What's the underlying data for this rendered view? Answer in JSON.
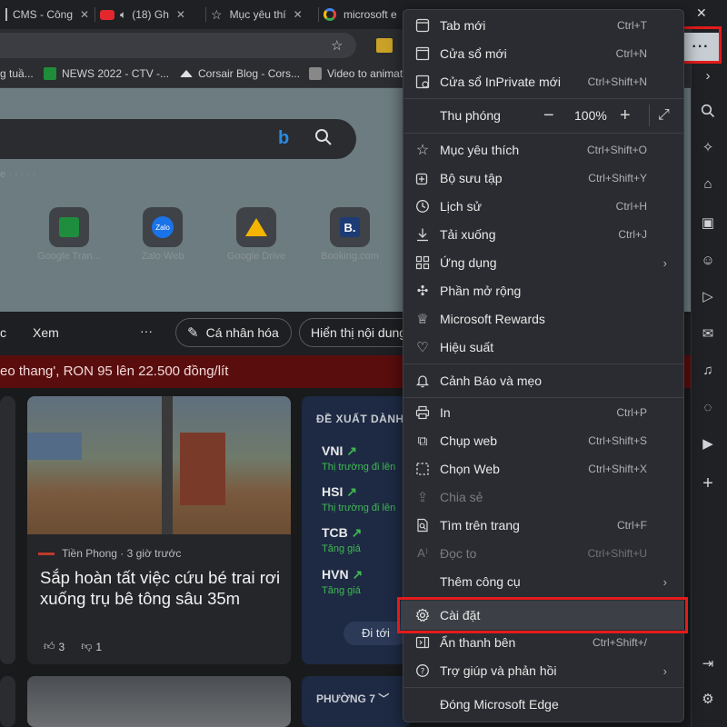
{
  "tabs": [
    {
      "label": "CMS - Công"
    },
    {
      "label": "(18) Gh"
    },
    {
      "label": "Mục yêu thí"
    },
    {
      "label": "microsoft e"
    }
  ],
  "favorites": [
    {
      "label": "g tuầ..."
    },
    {
      "label": "NEWS 2022 - CTV -..."
    },
    {
      "label": "Corsair Blog - Cors..."
    },
    {
      "label": "Video to animat"
    }
  ],
  "quick_access": [
    {
      "label": "Google Tran..."
    },
    {
      "label": "Zalo Web"
    },
    {
      "label": "Google Drive"
    },
    {
      "label": "Booking.com"
    }
  ],
  "news_nav": {
    "item_c": "c",
    "item_xem": "Xem",
    "more": "···",
    "personalize": "Cá nhân hóa",
    "display_content": "Hiển thị nội dung"
  },
  "ticker_text": "eo thang', RON 95 lên 22.500 đồng/lít",
  "news_card": {
    "source": "Tiền Phong · 3 giờ trước",
    "headline": "Sắp hoàn tất việc cứu bé trai rơi xuống trụ bê tông sâu 35m",
    "likes": "3",
    "dislikes": "1"
  },
  "stocks_panel": {
    "title": "ĐỀ XUẤT DÀNH",
    "items": [
      {
        "symbol": "VNI",
        "sub": "Thị trường đi lên"
      },
      {
        "symbol": "HSI",
        "sub": "Thị trường đi lên"
      },
      {
        "symbol": "TCB",
        "sub": "Tăng giá"
      },
      {
        "symbol": "HVN",
        "sub": "Tăng giá"
      }
    ],
    "goto": "Đi tới"
  },
  "bottom_panel_title": "PHƯỜNG 7",
  "menu": {
    "items": [
      {
        "label": "Tab mới",
        "shortcut": "Ctrl+T"
      },
      {
        "label": "Cửa sổ mới",
        "shortcut": "Ctrl+N"
      },
      {
        "label": "Cửa sổ InPrivate mới",
        "shortcut": "Ctrl+Shift+N"
      },
      {
        "label": "Thu phóng",
        "zoom": "100%"
      },
      {
        "label": "Mục yêu thích",
        "shortcut": "Ctrl+Shift+O"
      },
      {
        "label": "Bộ sưu tập",
        "shortcut": "Ctrl+Shift+Y"
      },
      {
        "label": "Lịch sử",
        "shortcut": "Ctrl+H"
      },
      {
        "label": "Tải xuống",
        "shortcut": "Ctrl+J"
      },
      {
        "label": "Ứng dụng"
      },
      {
        "label": "Phần mở rộng"
      },
      {
        "label": "Microsoft Rewards"
      },
      {
        "label": "Hiệu suất"
      },
      {
        "label": "Cảnh Báo và mẹo"
      },
      {
        "label": "In",
        "shortcut": "Ctrl+P"
      },
      {
        "label": "Chụp web",
        "shortcut": "Ctrl+Shift+S"
      },
      {
        "label": "Chọn Web",
        "shortcut": "Ctrl+Shift+X"
      },
      {
        "label": "Chia sẻ"
      },
      {
        "label": "Tìm trên trang",
        "shortcut": "Ctrl+F"
      },
      {
        "label": "Đọc to",
        "shortcut": "Ctrl+Shift+U"
      },
      {
        "label": "Thêm công cụ"
      },
      {
        "label": "Cài đặt"
      },
      {
        "label": "Ẩn thanh bên",
        "shortcut": "Ctrl+Shift+/"
      },
      {
        "label": "Trợ giúp và phản hồi"
      },
      {
        "label": "Đóng Microsoft Edge"
      }
    ]
  },
  "colors": {
    "highlight": "#e31b1b",
    "menu_bg": "#2a2c31",
    "stock_green": "#3fb950"
  }
}
